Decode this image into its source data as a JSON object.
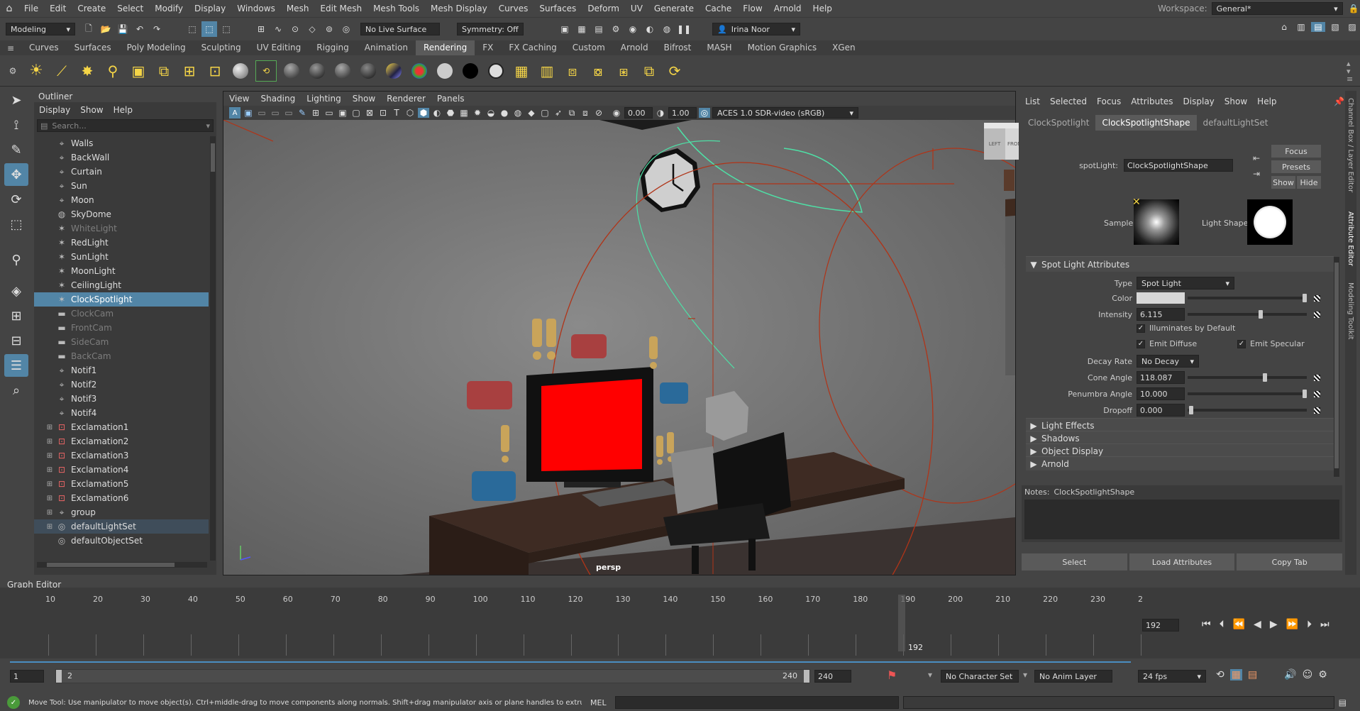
{
  "menubar": {
    "items": [
      "File",
      "Edit",
      "Create",
      "Select",
      "Modify",
      "Display",
      "Windows",
      "Mesh",
      "Edit Mesh",
      "Mesh Tools",
      "Mesh Display",
      "Curves",
      "Surfaces",
      "Deform",
      "UV",
      "Generate",
      "Cache",
      "Flow",
      "Arnold",
      "Help"
    ],
    "workspace_label": "Workspace:",
    "workspace_value": "General*"
  },
  "statusline": {
    "mode": "Modeling",
    "live_surface": "No Live Surface",
    "symmetry": "Symmetry: Off",
    "user": "Irina Noor"
  },
  "shelf": {
    "tabs": [
      "Curves",
      "Surfaces",
      "Poly Modeling",
      "Sculpting",
      "UV Editing",
      "Rigging",
      "Animation",
      "Rendering",
      "FX",
      "FX Caching",
      "Custom",
      "Arnold",
      "Bifrost",
      "MASH",
      "Motion Graphics",
      "XGen"
    ],
    "active_tab": "Rendering"
  },
  "outliner": {
    "title": "Outliner",
    "menu": [
      "Display",
      "Show",
      "Help"
    ],
    "search_placeholder": "Search...",
    "items": [
      {
        "label": "Walls",
        "type": "mesh",
        "dim": false,
        "expand": false
      },
      {
        "label": "BackWall",
        "type": "mesh",
        "dim": false,
        "expand": false
      },
      {
        "label": "Curtain",
        "type": "mesh",
        "dim": false,
        "expand": false
      },
      {
        "label": "Sun",
        "type": "mesh",
        "dim": false,
        "expand": false
      },
      {
        "label": "Moon",
        "type": "mesh",
        "dim": false,
        "expand": false
      },
      {
        "label": "SkyDome",
        "type": "sky",
        "dim": false,
        "expand": false
      },
      {
        "label": "WhiteLight",
        "type": "light",
        "dim": true,
        "expand": false
      },
      {
        "label": "RedLight",
        "type": "light",
        "dim": false,
        "expand": false
      },
      {
        "label": "SunLight",
        "type": "light",
        "dim": false,
        "expand": false
      },
      {
        "label": "MoonLight",
        "type": "light",
        "dim": false,
        "expand": false
      },
      {
        "label": "CeilingLight",
        "type": "light",
        "dim": false,
        "expand": false
      },
      {
        "label": "ClockSpotlight",
        "type": "light",
        "dim": false,
        "expand": false,
        "selected": true
      },
      {
        "label": "ClockCam",
        "type": "camera",
        "dim": true,
        "expand": false
      },
      {
        "label": "FrontCam",
        "type": "camera",
        "dim": true,
        "expand": false
      },
      {
        "label": "SideCam",
        "type": "camera",
        "dim": true,
        "expand": false
      },
      {
        "label": "BackCam",
        "type": "camera",
        "dim": true,
        "expand": false
      },
      {
        "label": "Notif1",
        "type": "mesh",
        "dim": false,
        "expand": false
      },
      {
        "label": "Notif2",
        "type": "mesh",
        "dim": false,
        "expand": false
      },
      {
        "label": "Notif3",
        "type": "mesh",
        "dim": false,
        "expand": false
      },
      {
        "label": "Notif4",
        "type": "mesh",
        "dim": false,
        "expand": false
      },
      {
        "label": "Exclamation1",
        "type": "group",
        "dim": false,
        "expand": true
      },
      {
        "label": "Exclamation2",
        "type": "group",
        "dim": false,
        "expand": true
      },
      {
        "label": "Exclamation3",
        "type": "group",
        "dim": false,
        "expand": true
      },
      {
        "label": "Exclamation4",
        "type": "group",
        "dim": false,
        "expand": true
      },
      {
        "label": "Exclamation5",
        "type": "group",
        "dim": false,
        "expand": true
      },
      {
        "label": "Exclamation6",
        "type": "group",
        "dim": false,
        "expand": true
      },
      {
        "label": "group",
        "type": "mesh",
        "dim": false,
        "expand": true
      },
      {
        "label": "defaultLightSet",
        "type": "set",
        "dim": false,
        "expand": true,
        "highlight": true
      },
      {
        "label": "defaultObjectSet",
        "type": "set",
        "dim": false,
        "expand": false
      }
    ]
  },
  "viewport": {
    "menu": [
      "View",
      "Shading",
      "Lighting",
      "Show",
      "Renderer",
      "Panels"
    ],
    "exposure": "0.00",
    "gamma": "1.00",
    "color_space": "ACES 1.0 SDR-video (sRGB)",
    "camera_label": "persp",
    "cube_left": "LEFT",
    "cube_front": "FRONT"
  },
  "attribute_editor": {
    "menu": [
      "List",
      "Selected",
      "Focus",
      "Attributes",
      "Display",
      "Show",
      "Help"
    ],
    "tabs": [
      "ClockSpotlight",
      "ClockSpotlightShape",
      "defaultLightSet"
    ],
    "active_tab": "ClockSpotlightShape",
    "node_label": "spotLight:",
    "node_value": "ClockSpotlightShape",
    "focus_btn": "Focus",
    "presets_btn": "Presets",
    "show_btn": "Show",
    "hide_btn": "Hide",
    "sample_label": "Sample",
    "light_shape_label": "Light Shape",
    "section_title": "Spot Light Attributes",
    "type_label": "Type",
    "type_value": "Spot Light",
    "color_label": "Color",
    "intensity_label": "Intensity",
    "intensity_value": "6.115",
    "illuminates_label": "Illuminates by Default",
    "emit_diffuse_label": "Emit Diffuse",
    "emit_specular_label": "Emit Specular",
    "decay_label": "Decay Rate",
    "decay_value": "No Decay",
    "cone_label": "Cone Angle",
    "cone_value": "118.087",
    "penumbra_label": "Penumbra Angle",
    "penumbra_value": "10.000",
    "dropoff_label": "Dropoff",
    "dropoff_value": "0.000",
    "collapsed_sections": [
      "Light Effects",
      "Shadows",
      "Object Display",
      "Arnold"
    ],
    "notes_label": "Notes:",
    "notes_value": "ClockSpotlightShape",
    "bottom_buttons": [
      "Select",
      "Load Attributes",
      "Copy Tab"
    ],
    "side_tabs": [
      "Channel Box / Layer Editor",
      "Attribute Editor",
      "Modeling Toolkit"
    ]
  },
  "graph_editor": {
    "title": "Graph Editor"
  },
  "timeline": {
    "ticks": [
      "10",
      "20",
      "30",
      "40",
      "50",
      "60",
      "70",
      "80",
      "90",
      "100",
      "110",
      "120",
      "130",
      "140",
      "150",
      "160",
      "170",
      "180",
      "190",
      "200",
      "210",
      "220",
      "230",
      "2"
    ],
    "current_frame": "192",
    "current_frame_field": "192"
  },
  "range": {
    "start": "1",
    "range_start": "2",
    "range_end": "240",
    "end": "240",
    "character_set": "No Character Set",
    "anim_layer": "No Anim Layer",
    "fps": "24 fps"
  },
  "helpline": {
    "text": "Move Tool: Use manipulator to move object(s). Ctrl+middle-drag to move components along normals. Shift+drag manipulator axis or plane handles to extrude components or c",
    "mel_label": "MEL"
  }
}
